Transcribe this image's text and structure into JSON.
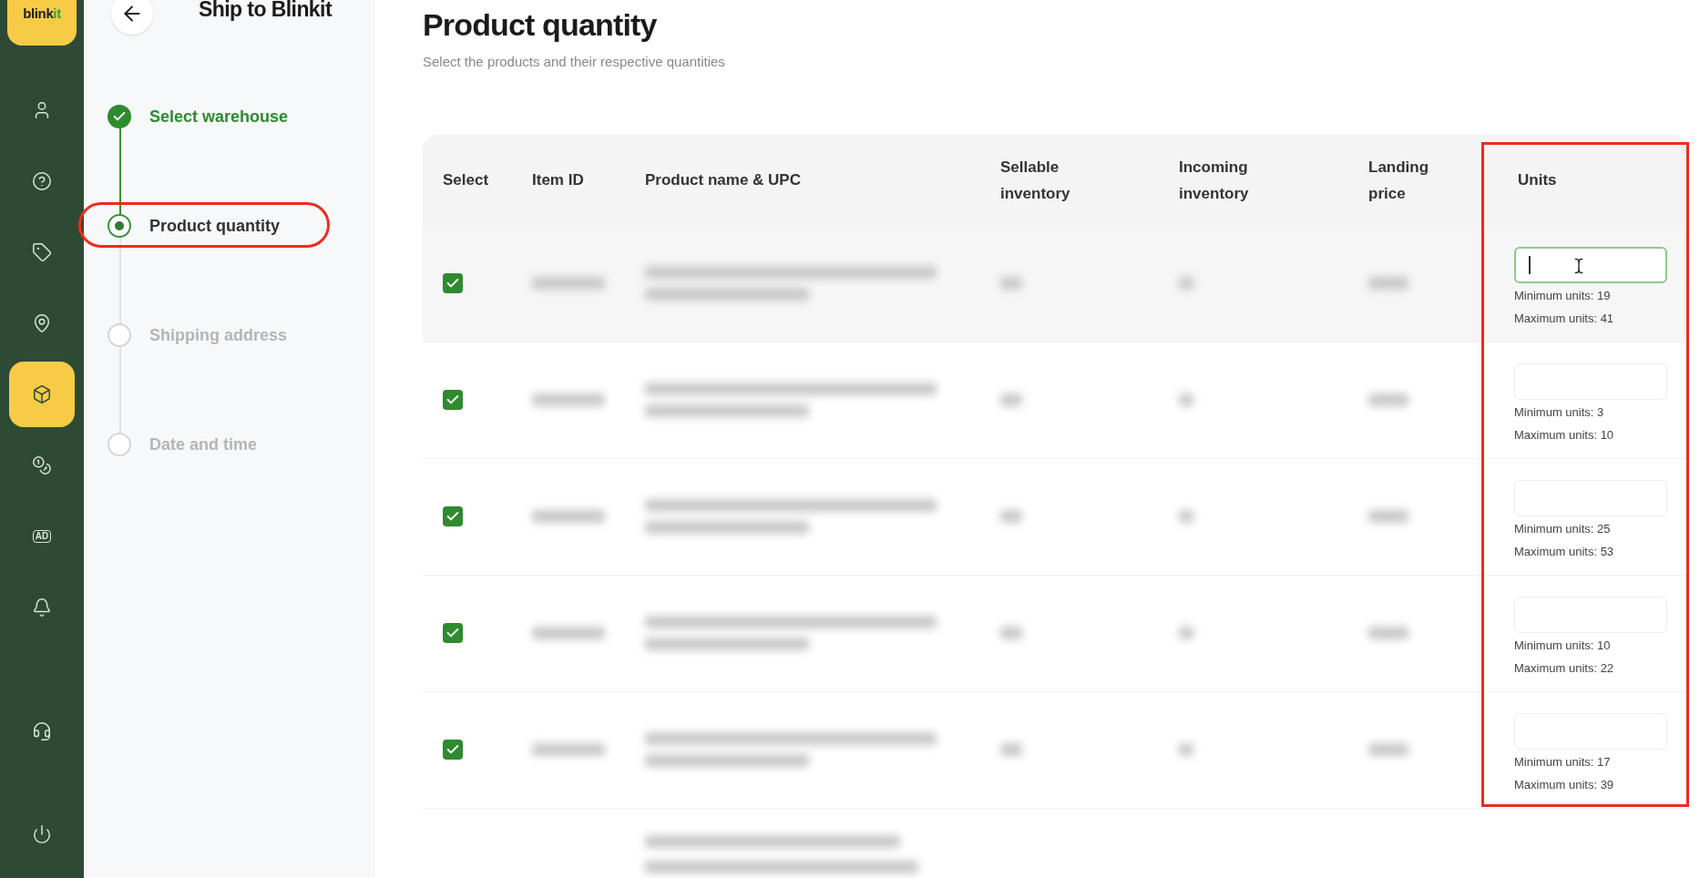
{
  "logo": {
    "text": "blink",
    "accent": "it"
  },
  "sidebar": {
    "items": [
      {
        "kind": "user",
        "selected": false
      },
      {
        "kind": "help",
        "selected": false
      },
      {
        "kind": "tag",
        "selected": false
      },
      {
        "kind": "location",
        "selected": false
      },
      {
        "kind": "box",
        "selected": true
      },
      {
        "kind": "coins",
        "selected": false
      },
      {
        "kind": "ad",
        "label": "AD",
        "selected": false
      },
      {
        "kind": "bell",
        "selected": false
      },
      {
        "kind": "headset",
        "selected": false
      },
      {
        "kind": "power",
        "selected": false
      }
    ]
  },
  "stepper": {
    "title": "Ship to Blinkit",
    "steps": [
      {
        "label": "Select warehouse",
        "kind": "done"
      },
      {
        "label": "Product quantity",
        "kind": "current"
      },
      {
        "label": "Shipping address",
        "kind": "pending"
      },
      {
        "label": "Date and time",
        "kind": "pending"
      }
    ]
  },
  "page": {
    "title": "Product quantity",
    "subtitle": "Select the products and their respective quantities"
  },
  "table": {
    "columns": [
      {
        "label": "Select",
        "outlined": false
      },
      {
        "label": "Item ID",
        "outlined": false
      },
      {
        "label": "Product name & UPC",
        "outlined": false
      },
      {
        "label": "Sellable inventory",
        "outlined": false
      },
      {
        "label": "Incoming inventory",
        "outlined": false
      },
      {
        "label": "Landing price",
        "outlined": false
      },
      {
        "label": "Units",
        "outlined": true
      }
    ],
    "rows": [
      {
        "checked": true,
        "focused": true,
        "min": "Minimum units: 19",
        "max": "Maximum units: 41"
      },
      {
        "checked": true,
        "focused": false,
        "min": "Minimum units: 3",
        "max": "Maximum units: 10"
      },
      {
        "checked": true,
        "focused": false,
        "min": "Minimum units: 25",
        "max": "Maximum units: 53"
      },
      {
        "checked": true,
        "focused": false,
        "min": "Minimum units: 10",
        "max": "Maximum units: 22"
      },
      {
        "checked": true,
        "focused": false,
        "min": "Minimum units: 17",
        "max": "Maximum units: 39"
      }
    ]
  }
}
